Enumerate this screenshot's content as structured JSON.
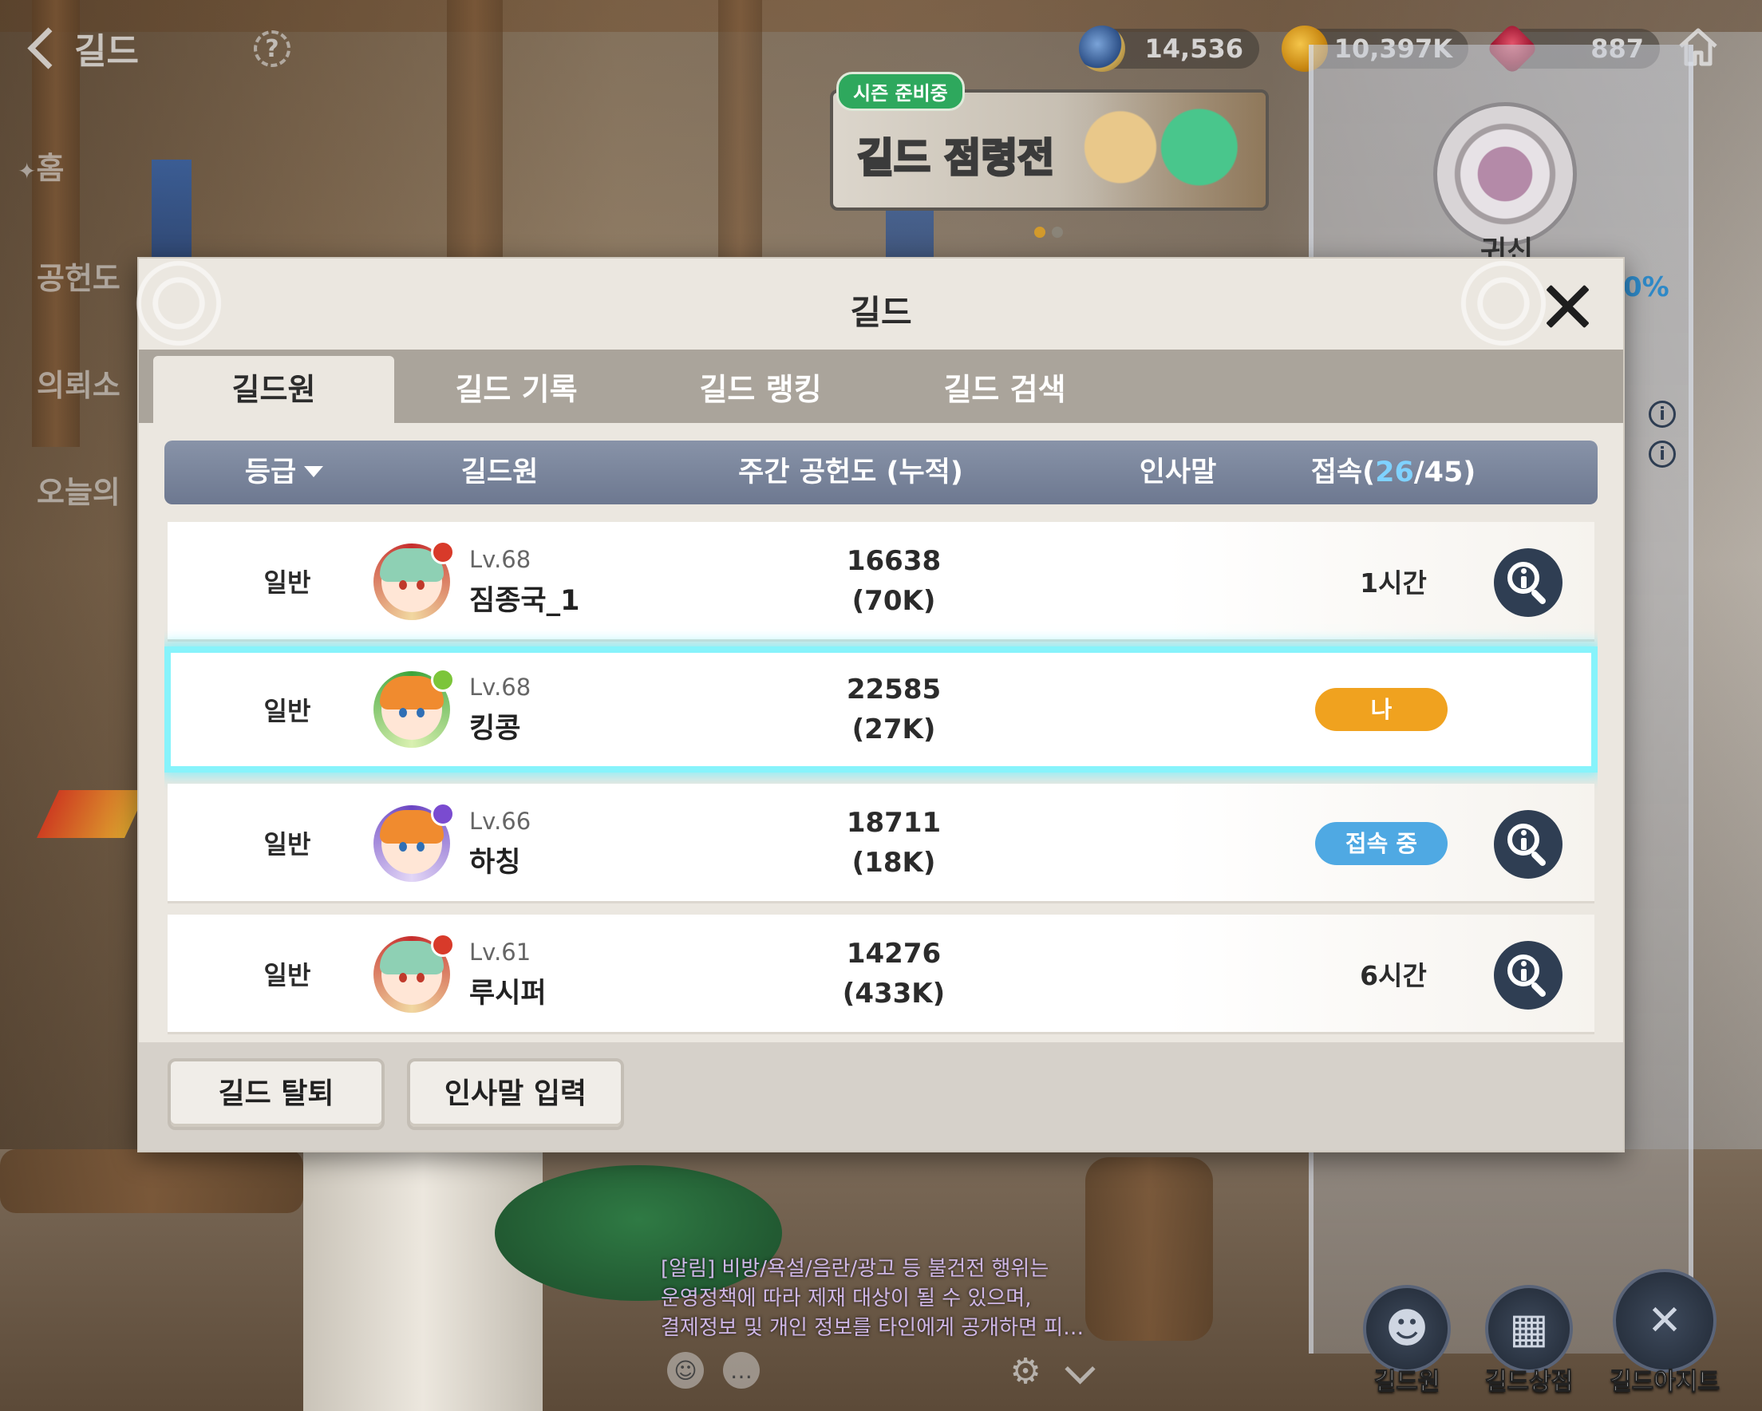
{
  "header": {
    "title": "길드",
    "help_icon": "question-icon"
  },
  "side_menu": [
    "홈",
    "공헌도",
    "의뢰소",
    "오늘의"
  ],
  "currencies": [
    {
      "icon": "globe-token-icon",
      "value": "14,536"
    },
    {
      "icon": "gold-coin-icon",
      "value": "10,397K"
    },
    {
      "icon": "red-gem-icon",
      "value": "887"
    }
  ],
  "event": {
    "badge": "시즌 준비중",
    "title": "길드 점령전"
  },
  "right_panel": {
    "emblem_label": "귀신",
    "percent": "0%"
  },
  "modal": {
    "title": "길드",
    "tabs": [
      "길드원",
      "길드 기록",
      "길드 랭킹",
      "길드 검색"
    ],
    "active_tab": "길드원",
    "columns": {
      "grade": "등급",
      "member": "길드원",
      "contribution": "주간 공헌도 (누적)",
      "greeting": "인사말",
      "connection_prefix": "접속(",
      "connection_online": "26",
      "connection_suffix": "/45)"
    },
    "members": [
      {
        "grade": "일반",
        "level": "Lv.68",
        "name": "짐종국_1",
        "weekly": "16638",
        "total": "(70K)",
        "status": "1시간",
        "status_type": "text",
        "has_info": true
      },
      {
        "grade": "일반",
        "level": "Lv.68",
        "name": "킹콩",
        "weekly": "22585",
        "total": "(27K)",
        "status": "나",
        "status_type": "me",
        "has_info": false
      },
      {
        "grade": "일반",
        "level": "Lv.66",
        "name": "하칭",
        "weekly": "18711",
        "total": "(18K)",
        "status": "접속 중",
        "status_type": "online",
        "has_info": true
      },
      {
        "grade": "일반",
        "level": "Lv.61",
        "name": "루시퍼",
        "weekly": "14276",
        "total": "(433K)",
        "status": "6시간",
        "status_type": "text",
        "has_info": true
      }
    ],
    "footer": {
      "leave": "길드 탈퇴",
      "greeting_input": "인사말 입력"
    }
  },
  "notice": [
    "[알림] 비방/욕설/음란/광고 등 불건전 행위는",
    "운영정책에 따라 제재 대상이 될 수 있으며,",
    "결제정보 및 개인 정보를 타인에게 공개하면 피…"
  ],
  "bottom_nav": [
    {
      "label": "길드원",
      "icon": "members-icon"
    },
    {
      "label": "길드상점",
      "icon": "shop-basket-icon"
    },
    {
      "label": "길드아지트",
      "icon": "guild-hideout-icon"
    }
  ],
  "colors": {
    "accent_online": "#4fa9e3",
    "accent_me": "#f0a21f",
    "highlight_row": "#87f3fb",
    "header_bar": "#7a859b"
  }
}
